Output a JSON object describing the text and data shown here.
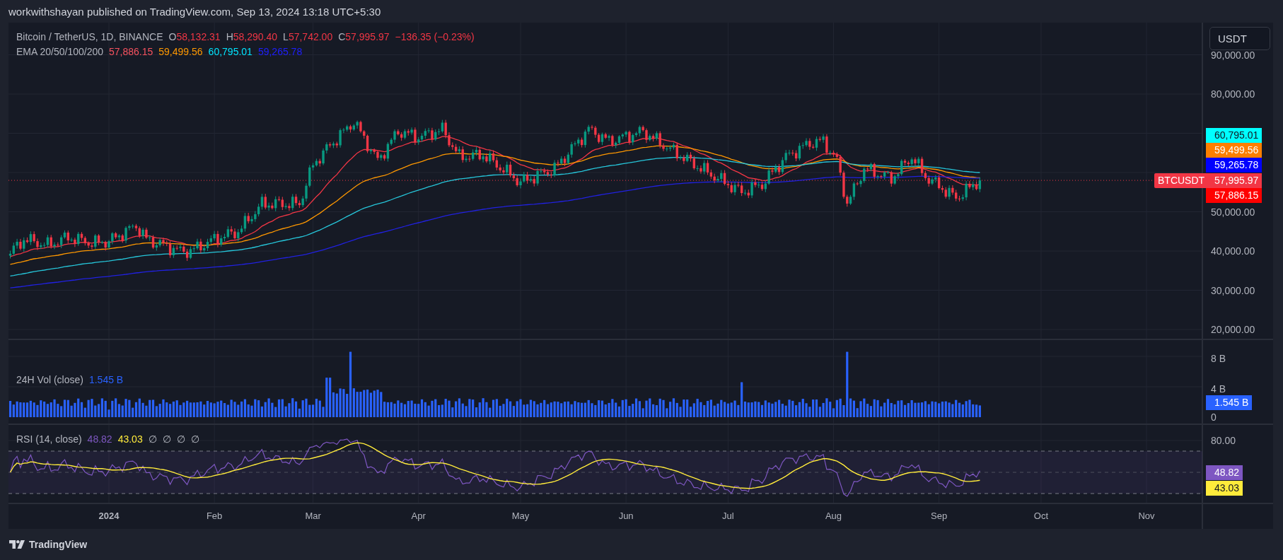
{
  "header": {
    "text": "workwithshayan published on TradingView.com, Sep 13, 2024 13:18 UTC+5:30"
  },
  "legend": {
    "symbol": "Bitcoin / TetherUS, 1D, BINANCE",
    "ohlc": [
      {
        "label": "O",
        "value": "58,132.31"
      },
      {
        "label": "H",
        "value": "58,290.40"
      },
      {
        "label": "L",
        "value": "57,742.00"
      },
      {
        "label": "C",
        "value": "57,995.97"
      }
    ],
    "change": "−136.35 (−0.23%)"
  },
  "ema_legend": {
    "label": "EMA 20/50/100/200",
    "values": [
      {
        "value": "57,886.15",
        "color": "#f7525f"
      },
      {
        "value": "59,499.56",
        "color": "#ff9800"
      },
      {
        "value": "60,795.01",
        "color": "#00e5ff"
      },
      {
        "value": "59,265.78",
        "color": "#1f1fff"
      }
    ]
  },
  "currency_button": "USDT",
  "price_axis": {
    "ticks": [
      "90,000.00",
      "80,000.00",
      "50,000.00",
      "40,000.00",
      "30,000.00",
      "20,000.00"
    ],
    "labels": [
      {
        "text": "60,795.01",
        "color": "#00ffff"
      },
      {
        "text": "59,499.56",
        "color": "#ff7f00"
      },
      {
        "text": "59,265.78",
        "color": "#0000ff"
      },
      {
        "text": "57,995.97",
        "color": "#f23645"
      },
      {
        "text": "57,886.15",
        "color": "#ff0000"
      }
    ]
  },
  "symbol_label": {
    "text": "BTCUSDT",
    "color": "#f23645"
  },
  "volume": {
    "title": "24H Vol (close)",
    "value": "1.545 B",
    "ticks": [
      "8 B",
      "4 B",
      "0"
    ],
    "label": {
      "text": "1.545 B",
      "color": "#2962ff"
    }
  },
  "rsi": {
    "title": "RSI (14, close)",
    "values": [
      {
        "value": "48.82",
        "color": "#7e57c2"
      },
      {
        "value": "43.03",
        "color": "#ffeb3b"
      }
    ],
    "empty_values": [
      "∅",
      "∅",
      "∅",
      "∅"
    ],
    "ticks": [
      "80.00"
    ],
    "labels": [
      {
        "text": "48.82",
        "color": "#7e57c2"
      },
      {
        "text": "43.03",
        "color": "#ffeb3b"
      }
    ]
  },
  "time_axis": [
    {
      "label": "2024",
      "bold": true
    },
    {
      "label": "Feb",
      "bold": false
    },
    {
      "label": "Mar",
      "bold": false
    },
    {
      "label": "Apr",
      "bold": false
    },
    {
      "label": "May",
      "bold": false
    },
    {
      "label": "Jun",
      "bold": false
    },
    {
      "label": "Jul",
      "bold": false
    },
    {
      "label": "Aug",
      "bold": false
    },
    {
      "label": "Sep",
      "bold": false
    },
    {
      "label": "Oct",
      "bold": false
    },
    {
      "label": "Nov",
      "bold": false
    }
  ],
  "footer": {
    "brand": "TradingView"
  }
}
